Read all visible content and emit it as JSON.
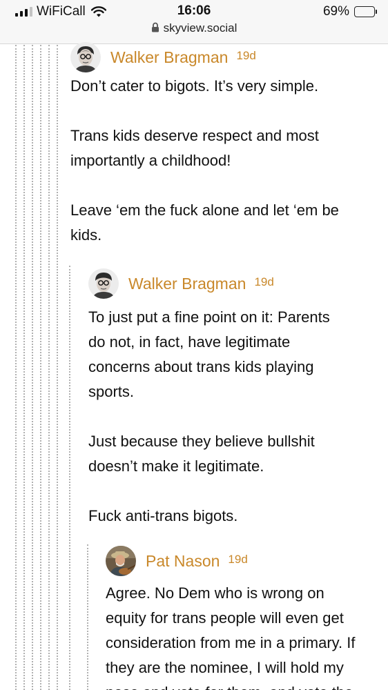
{
  "status_bar": {
    "carrier": "WiFiCall",
    "time": "16:06",
    "battery_percent": "69%",
    "battery_level": 0.69,
    "signal_icon": "signal-bars-icon",
    "wifi_icon": "wifi-icon"
  },
  "browser": {
    "url": "skyview.social",
    "lock_icon": "lock-icon"
  },
  "thread": {
    "posts": [
      {
        "author": "Walker Bragman",
        "age": "19d",
        "lines": [
          "Don’t cater to bigots. It’s very simple.",
          "",
          "Trans kids deserve respect and most",
          "importantly a childhood!",
          "",
          "Leave ‘em the fuck alone and let ‘em be",
          "kids."
        ]
      },
      {
        "author": "Walker Bragman",
        "age": "19d",
        "lines": [
          "To just put a fine point on it: Parents",
          "do not, in fact, have legitimate",
          "concerns about trans kids playing",
          "sports.",
          "",
          "Just because they believe bullshit",
          "doesn’t make it legitimate.",
          "",
          "Fuck anti-trans bigots."
        ]
      },
      {
        "author": "Pat Nason",
        "age": "19d",
        "lines": [
          "Agree. No Dem who is wrong on",
          "equity for trans people will even get",
          "consideration from me in a primary. If",
          "they are the nominee, I will hold my",
          "nose and vote for them, and vote the"
        ]
      }
    ]
  }
}
